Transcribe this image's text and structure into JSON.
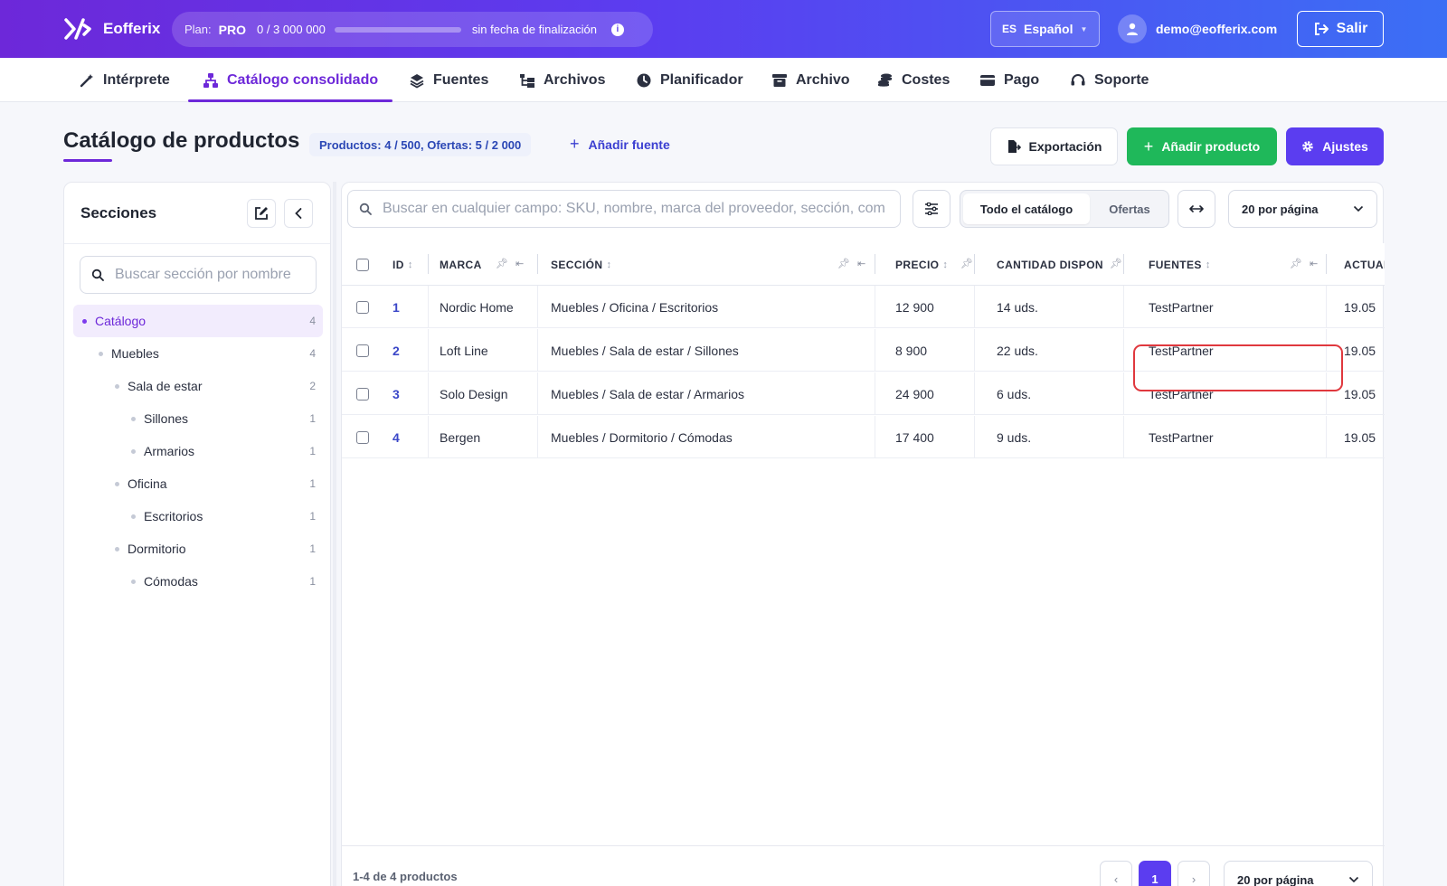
{
  "app": {
    "name": "Eofferix"
  },
  "plan": {
    "label": "Plan:",
    "tier": "PRO",
    "usage": "0  /  3 000 000",
    "usage_fraction": 0,
    "expiry": "sin fecha de finalización"
  },
  "language": {
    "code": "ES",
    "name": "Español"
  },
  "user": {
    "email": "demo@eofferix.com"
  },
  "logout": {
    "label": "Salir"
  },
  "nav": [
    {
      "label": "Intérprete",
      "icon": "wand-icon"
    },
    {
      "label": "Catálogo consolidado",
      "icon": "sitemap-icon",
      "active": true
    },
    {
      "label": "Fuentes",
      "icon": "layers-icon"
    },
    {
      "label": "Archivos",
      "icon": "folder-tree-icon"
    },
    {
      "label": "Planificador",
      "icon": "clock-icon"
    },
    {
      "label": "Archivo",
      "icon": "archive-box-icon"
    },
    {
      "label": "Costes",
      "icon": "coins-icon"
    },
    {
      "label": "Pago",
      "icon": "credit-card-icon"
    },
    {
      "label": "Soporte",
      "icon": "headset-icon"
    }
  ],
  "page": {
    "title": "Catálogo de productos",
    "counts": "Productos: 4 / 500, Ofertas: 5 / 2 000",
    "add_source": "Añadir fuente",
    "export": "Exportación",
    "add_product": "Añadir producto",
    "settings": "Ajustes"
  },
  "sidebar": {
    "title": "Secciones",
    "search_placeholder": "Buscar sección por nombre",
    "tree": [
      {
        "label": "Catálogo",
        "count": "4",
        "level": 0,
        "selected": true
      },
      {
        "label": "Muebles",
        "count": "4",
        "level": 1
      },
      {
        "label": "Sala de estar",
        "count": "2",
        "level": 2
      },
      {
        "label": "Sillones",
        "count": "1",
        "level": 3
      },
      {
        "label": "Armarios",
        "count": "1",
        "level": 3
      },
      {
        "label": "Oficina",
        "count": "1",
        "level": 2
      },
      {
        "label": "Escritorios",
        "count": "1",
        "level": 3
      },
      {
        "label": "Dormitorio",
        "count": "1",
        "level": 2
      },
      {
        "label": "Cómodas",
        "count": "1",
        "level": 3
      }
    ]
  },
  "toolbar": {
    "search_placeholder": "Buscar en cualquier campo: SKU, nombre, marca del proveedor, sección, com",
    "segment_all": "Todo el catálogo",
    "segment_offers": "Ofertas",
    "per_page": "20 por página"
  },
  "table": {
    "columns": {
      "id": "ID",
      "brand": "MARCA",
      "section": "SECCIÓN",
      "price": "PRECIO",
      "qty": "CANTIDAD DISPONIBLE",
      "sources": "FUENTES",
      "updated": "ACTUALIZADO"
    },
    "rows": [
      {
        "id": "1",
        "brand": "Nordic Home",
        "section": "Muebles / Oficina / Escritorios",
        "price": "12 900",
        "qty": "14 uds.",
        "sources": "TestPartner",
        "updated": "19.05"
      },
      {
        "id": "2",
        "brand": "Loft Line",
        "section": "Muebles / Sala de estar / Sillones",
        "price": "8 900",
        "qty": "22 uds.",
        "sources": "TestPartner",
        "updated": "19.05"
      },
      {
        "id": "3",
        "brand": "Solo Design",
        "section": "Muebles / Sala de estar / Armarios",
        "price": "24 900",
        "qty": "6 uds.",
        "sources": "TestPartner",
        "updated": "19.05"
      },
      {
        "id": "4",
        "brand": "Bergen",
        "section": "Muebles / Dormitorio / Cómodas",
        "price": "17 400",
        "qty": "9 uds.",
        "sources": "TestPartner",
        "updated": "19.05"
      }
    ]
  },
  "footer": {
    "info": "1-4 de 4 productos",
    "current_page": "1",
    "prev": "‹",
    "next": "›",
    "per_page": "20 por página"
  },
  "colors": {
    "accent": "#6d28d9",
    "primary": "#5b3df0",
    "success": "#1fb85a",
    "highlight": "#e0383e"
  }
}
